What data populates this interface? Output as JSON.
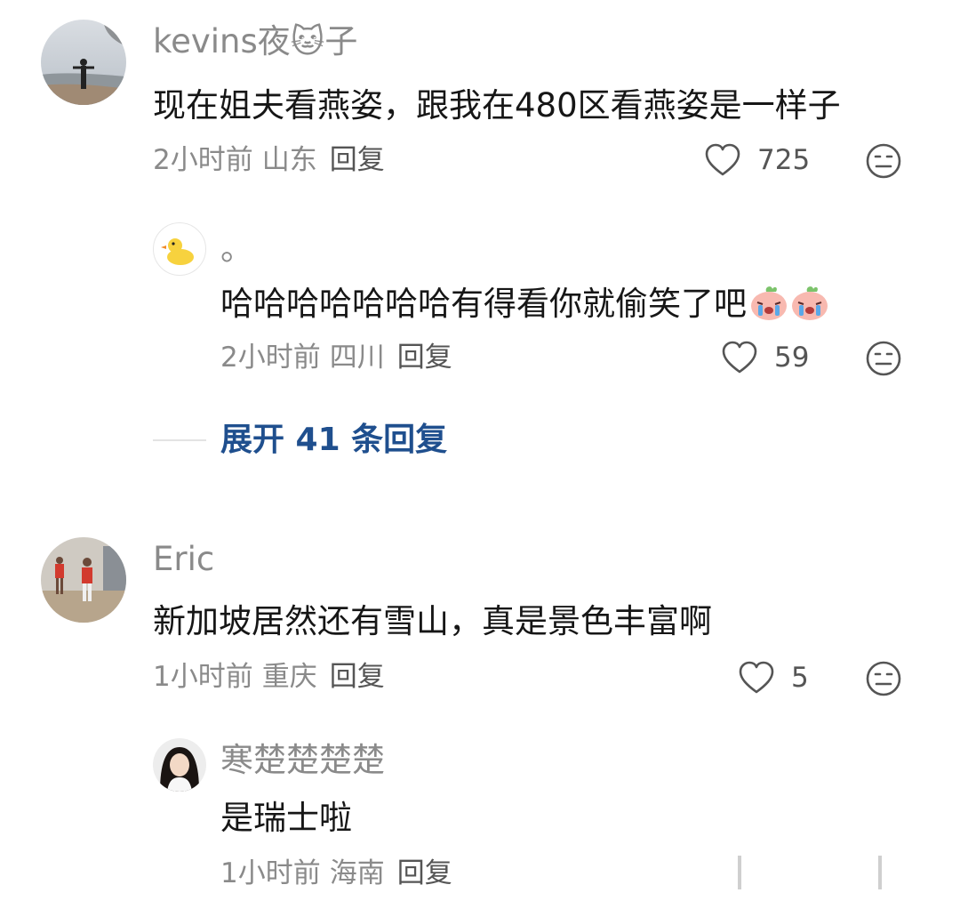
{
  "comments": [
    {
      "username": "kevins夜🐱子",
      "text": "现在姐夫看燕姿，跟我在480区看燕姿是一样子",
      "time": "2小时前",
      "location": "山东",
      "reply_label": "回复",
      "likes": "725",
      "replies": [
        {
          "username": "。",
          "text": "哈哈哈哈哈哈哈有得看你就偷笑了吧",
          "time": "2小时前",
          "location": "四川",
          "reply_label": "回复",
          "likes": "59"
        }
      ],
      "expand_label": "展开 41 条回复"
    },
    {
      "username": "Eric",
      "text": "新加坡居然还有雪山，真是景色丰富啊",
      "time": "1小时前",
      "location": "重庆",
      "reply_label": "回复",
      "likes": "5",
      "replies": [
        {
          "username": "寒楚楚楚楚",
          "text": "是瑞士啦",
          "time": "1小时前",
          "location": "海南",
          "reply_label": "回复"
        }
      ]
    }
  ],
  "icons": {
    "like": "heart-outline-icon",
    "dislike": "meh-face-icon",
    "emoji": "crying-laugh-peach-emoji"
  },
  "colors": {
    "text_primary": "#161616",
    "text_secondary": "#8a8a8a",
    "link": "#1f4f8e"
  }
}
